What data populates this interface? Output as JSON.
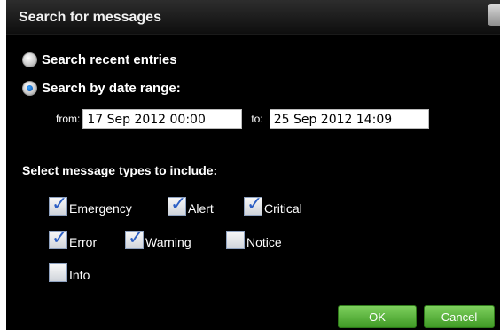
{
  "dialog": {
    "title": "Search for messages",
    "options": {
      "recent_label": "Search recent entries",
      "range_label": "Search by date range:",
      "selected": "range"
    },
    "range": {
      "from_label": "from:",
      "from_value": "17 Sep 2012 00:00",
      "to_label": "to:",
      "to_value": "25 Sep 2012 14:09"
    },
    "types_heading": "Select message types to include:",
    "types": [
      {
        "label": "Emergency",
        "checked": true
      },
      {
        "label": "Alert",
        "checked": true
      },
      {
        "label": "Critical",
        "checked": true
      },
      {
        "label": "Error",
        "checked": true
      },
      {
        "label": "Warning",
        "checked": true
      },
      {
        "label": "Notice",
        "checked": false
      },
      {
        "label": "Info",
        "checked": false
      }
    ],
    "buttons": {
      "ok": "OK",
      "cancel": "Cancel"
    },
    "colors": {
      "accent_green": "#4caf2e",
      "check_blue": "#2c5fc4",
      "background": "#000000"
    }
  }
}
